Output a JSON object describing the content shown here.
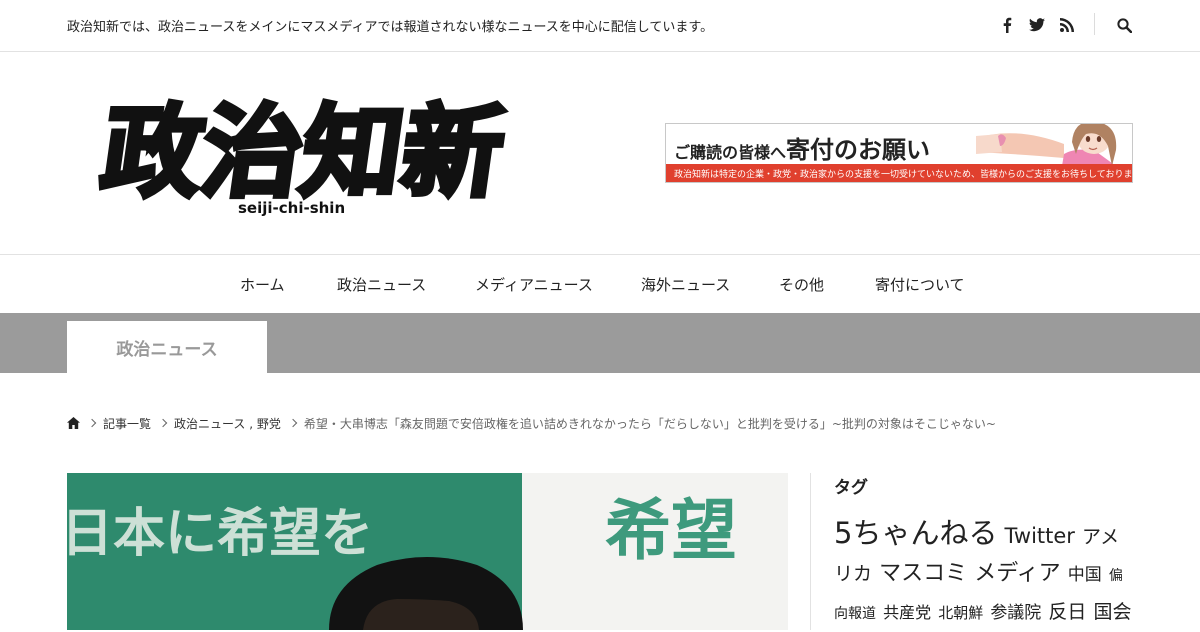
{
  "topbar": {
    "tagline": "政治知新では、政治ニュースをメインにマスメディアでは報道されない様なニュースを中心に配信しています。",
    "icons": [
      "facebook-icon",
      "twitter-icon",
      "rss-icon",
      "search-icon"
    ]
  },
  "logo": {
    "text": "政治知新",
    "sub": "seiji-chi-shin"
  },
  "banner": {
    "head_small_1": "ご購読の皆様へ",
    "head_big": "寄付のお願い",
    "sub": "政治知新は特定の企業・政党・政治家からの支援を一切受けていないため、皆様からのご支援をお待ちしております。"
  },
  "nav": {
    "items": [
      "ホーム",
      "政治ニュース",
      "メディアニュース",
      "海外ニュース",
      "その他",
      "寄付について"
    ]
  },
  "category": {
    "label": "政治ニュース"
  },
  "breadcrumb": {
    "items": [
      "記事一覧",
      "政治ニュース , 野党"
    ],
    "current": "希望・大串博志「森友問題で安倍政権を追い詰めきれなかったら「だらしない」と批判を受ける」~批判の対象はそこじゃない~"
  },
  "hero": {
    "sign_left": "日本に希望を",
    "sign_right": "希望"
  },
  "sidebar": {
    "title": "タグ",
    "tags": [
      {
        "label": "5ちゃんねる",
        "size": 29
      },
      {
        "label": "Twitter",
        "size": 21
      },
      {
        "label": "アメリカ",
        "size": 19
      },
      {
        "label": "マスコミ",
        "size": 22
      },
      {
        "label": "メディア",
        "size": 22
      },
      {
        "label": "中国",
        "size": 17
      },
      {
        "label": "偏向報道",
        "size": 14
      },
      {
        "label": "共産党",
        "size": 16
      },
      {
        "label": "北朝鮮",
        "size": 15
      },
      {
        "label": "参議院",
        "size": 17
      },
      {
        "label": "反日",
        "size": 19
      },
      {
        "label": "国会",
        "size": 19
      }
    ]
  },
  "colors": {
    "band": "#9b9b9b",
    "banner_red": "#e0402e",
    "hero_green": "#2e8a6d"
  }
}
